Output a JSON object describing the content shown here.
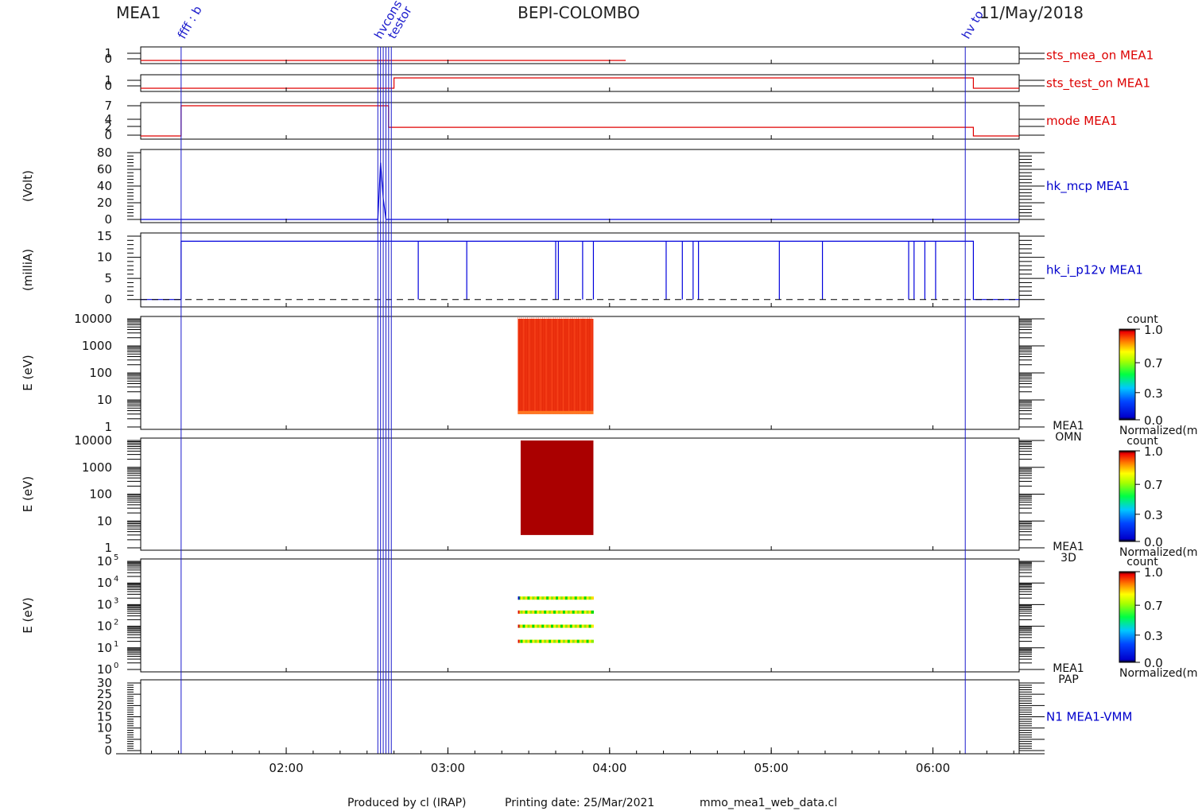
{
  "header": {
    "instrument": "MEA1",
    "mission": "BEPI-COLOMBO",
    "date": "11/May/2018"
  },
  "footer": {
    "produced_by": "Produced by cl (IRAP)",
    "printing_date": "Printing date: 25/Mar/2021",
    "script": "mmo_mea1_web_data.cl"
  },
  "time_axis": {
    "range": [
      "01:06",
      "06:32"
    ],
    "ticks": [
      "02:00",
      "03:00",
      "04:00",
      "05:00",
      "06:00"
    ]
  },
  "event_lines": [
    {
      "time": "01:21",
      "label": "ffff : b"
    },
    {
      "time": "02:34",
      "label": "hvcons"
    },
    {
      "time": "02:35",
      "label": ""
    },
    {
      "time": "02:36",
      "label": ""
    },
    {
      "time": "02:37",
      "label": ""
    },
    {
      "time": "02:38",
      "label": ""
    },
    {
      "time": "02:39",
      "label": "testor"
    },
    {
      "time": "06:12",
      "label": "hv to"
    }
  ],
  "colors": {
    "red_trace": "#e00000",
    "blue_trace": "#0000dd",
    "axis": "#000000",
    "spectrogram_omn": "#ee3311",
    "spectrogram_3d": "#aa0000"
  },
  "chart_data": [
    {
      "type": "line",
      "panel": "sts_mea_on",
      "label": "sts_mea_on MEA1",
      "yticks": [
        "1",
        "0"
      ],
      "ylim": [
        0,
        1
      ],
      "series": [
        {
          "x": [
            "01:06",
            "04:06",
            "04:17",
            "04:18",
            "04:21",
            "06:32"
          ],
          "values": [
            0,
            0,
            null,
            0,
            null,
            0
          ]
        }
      ]
    },
    {
      "type": "line",
      "panel": "sts_test_on",
      "label": "sts_test_on MEA1",
      "yticks": [
        "1",
        "0"
      ],
      "ylim": [
        0,
        1
      ],
      "series": [
        {
          "x": [
            "01:06",
            "02:40",
            "02:40",
            "04:06",
            "04:21",
            "06:15",
            "06:15",
            "06:32"
          ],
          "values": [
            0,
            0,
            1,
            1,
            1,
            1,
            0,
            0
          ]
        }
      ]
    },
    {
      "type": "line",
      "panel": "mode",
      "label": "mode MEA1",
      "yticks": [
        "7",
        "4",
        "2",
        "0"
      ],
      "ylim": [
        0,
        7
      ],
      "series": [
        {
          "x": [
            "01:06",
            "01:21",
            "01:21",
            "02:38",
            "02:38",
            "06:15",
            "06:15",
            "06:32"
          ],
          "values": [
            0,
            0,
            7,
            7,
            2,
            2,
            0,
            0
          ]
        }
      ]
    },
    {
      "type": "line",
      "panel": "hk_mcp",
      "label": "hk_mcp MEA1",
      "ylabel": "(Volt)",
      "yticks": [
        "80",
        "60",
        "40",
        "20",
        "0"
      ],
      "ylim": [
        0,
        80
      ],
      "series": [
        {
          "x": [
            "01:06",
            "02:34",
            "02:35",
            "02:36",
            "02:37",
            "06:32"
          ],
          "values": [
            0,
            0,
            68,
            25,
            0,
            0
          ]
        }
      ]
    },
    {
      "type": "line",
      "panel": "hk_i_p12v",
      "label": "hk_i_p12v MEA1",
      "ylabel": "(milliA)",
      "yticks": [
        "15",
        "10",
        "5",
        "0"
      ],
      "ylim": [
        -1,
        15
      ],
      "series": [
        {
          "x": [
            "01:06",
            "01:21",
            "01:21",
            "06:15",
            "06:15",
            "06:32"
          ],
          "values": [
            0,
            0,
            13.8,
            13.8,
            0,
            0
          ]
        }
      ],
      "dropouts": [
        "02:49",
        "03:07",
        "03:40",
        "03:41",
        "03:50",
        "03:54",
        "04:21",
        "04:27",
        "04:31",
        "04:33",
        "05:03",
        "05:19",
        "05:51",
        "05:53",
        "05:57",
        "06:01"
      ]
    },
    {
      "type": "heatmap",
      "panel": "MEA1 OMN",
      "labels": [
        "MEA1",
        "OMN"
      ],
      "ylabel": "E (eV)",
      "yticks": [
        "10000",
        "1000",
        "100",
        "10",
        "1"
      ],
      "yscale": "log",
      "ylim": [
        1,
        10000
      ],
      "block": {
        "t0": "03:26",
        "t1": "03:54",
        "e0": 3,
        "e1": 10000,
        "level": 0.95
      },
      "colorbar": {
        "title": "count",
        "ticks": [
          "1.0",
          "0.7",
          "0.3",
          "0.0"
        ],
        "label": "Normalized(m"
      }
    },
    {
      "type": "heatmap",
      "panel": "MEA1 3D",
      "labels": [
        "MEA1",
        "3D"
      ],
      "ylabel": "E (eV)",
      "yticks": [
        "10000",
        "1000",
        "100",
        "10",
        "1"
      ],
      "yscale": "log",
      "ylim": [
        1,
        10000
      ],
      "block": {
        "t0": "03:27",
        "t1": "03:54",
        "e0": 3,
        "e1": 10000,
        "level": 1.0
      },
      "colorbar": {
        "title": "count",
        "ticks": [
          "1.0",
          "0.7",
          "0.3",
          "0.0"
        ],
        "label": "Normalized(m"
      }
    },
    {
      "type": "heatmap",
      "panel": "MEA1 PAP",
      "labels": [
        "MEA1",
        "PAP"
      ],
      "ylabel": "E (eV)",
      "yticks": [
        "10",
        "10",
        "10",
        "10",
        "10",
        "10"
      ],
      "ytick_exponents": [
        "5",
        "4",
        "3",
        "2",
        "1",
        "0"
      ],
      "yscale": "log",
      "ylim": [
        1,
        100000
      ],
      "bands": [
        {
          "t0": "03:26",
          "t1": "03:54",
          "energy": 2000
        },
        {
          "t0": "03:26",
          "t1": "03:54",
          "energy": 450
        },
        {
          "t0": "03:26",
          "t1": "03:54",
          "energy": 100
        },
        {
          "t0": "03:26",
          "t1": "03:54",
          "energy": 20
        }
      ],
      "colorbar": {
        "title": "count",
        "ticks": [
          "1.0",
          "0.7",
          "0.3",
          "0.0"
        ],
        "label": "Normalized(m"
      }
    },
    {
      "type": "line",
      "panel": "N1",
      "label": "N1 MEA1-VMM",
      "yticks": [
        "30",
        "25",
        "20",
        "15",
        "10",
        "5",
        "0"
      ],
      "ylim": [
        0,
        30
      ],
      "series": []
    }
  ]
}
